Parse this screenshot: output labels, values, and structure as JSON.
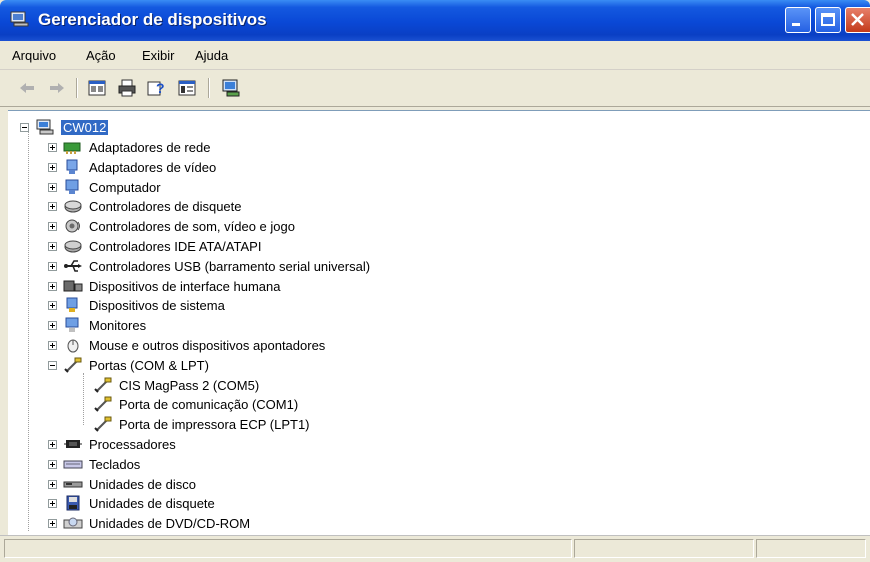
{
  "window": {
    "title": "Gerenciador de dispositivos"
  },
  "menu": {
    "items": [
      "Arquivo",
      "Ação",
      "Exibir",
      "Ajuda"
    ]
  },
  "toolbar": {
    "buttons": [
      "back-arrow-icon",
      "forward-arrow-icon",
      "properties-icon",
      "print-icon",
      "help-icon",
      "view-icon",
      "scan-hardware-icon"
    ]
  },
  "tree": {
    "root": "CW012",
    "items": [
      {
        "label": "Adaptadores de rede",
        "icon": "network-adapter-icon"
      },
      {
        "label": "Adaptadores de vídeo",
        "icon": "display-adapter-icon"
      },
      {
        "label": "Computador",
        "icon": "computer-icon"
      },
      {
        "label": "Controladores de disquete",
        "icon": "floppy-controller-icon"
      },
      {
        "label": "Controladores de som, vídeo e jogo",
        "icon": "sound-icon"
      },
      {
        "label": "Controladores IDE ATA/ATAPI",
        "icon": "ide-controller-icon"
      },
      {
        "label": "Controladores USB (barramento serial universal)",
        "icon": "usb-icon"
      },
      {
        "label": "Dispositivos de interface humana",
        "icon": "hid-icon"
      },
      {
        "label": "Dispositivos de sistema",
        "icon": "system-device-icon"
      },
      {
        "label": "Monitores",
        "icon": "monitor-icon"
      },
      {
        "label": "Mouse e outros dispositivos apontadores",
        "icon": "mouse-icon"
      },
      {
        "label": "Portas (COM & LPT)",
        "icon": "port-icon",
        "expanded": true,
        "children": [
          {
            "label": "CIS MagPass 2 (COM5)",
            "icon": "port-icon"
          },
          {
            "label": "Porta de comunicação (COM1)",
            "icon": "port-icon"
          },
          {
            "label": "Porta de impressora ECP (LPT1)",
            "icon": "port-icon"
          }
        ]
      },
      {
        "label": "Processadores",
        "icon": "processor-icon"
      },
      {
        "label": "Teclados",
        "icon": "keyboard-icon"
      },
      {
        "label": "Unidades de disco",
        "icon": "disk-drive-icon"
      },
      {
        "label": "Unidades de disquete",
        "icon": "floppy-drive-icon"
      },
      {
        "label": "Unidades de DVD/CD-ROM",
        "icon": "dvd-drive-icon"
      }
    ]
  },
  "colors": {
    "title_bar": "#0a48d6",
    "selection": "#316ac5",
    "chrome": "#ece9d8"
  }
}
